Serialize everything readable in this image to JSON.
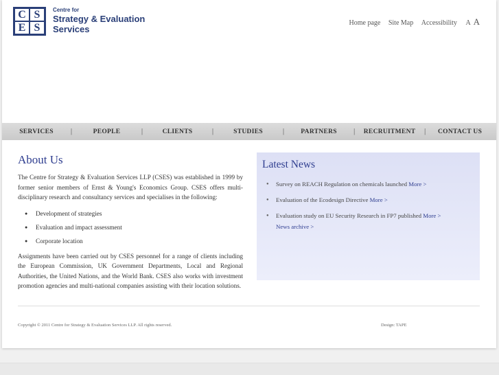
{
  "logo": {
    "letters": [
      "C",
      "S",
      "E",
      "S"
    ],
    "line1": "Centre for",
    "line2": "Strategy & Evaluation",
    "line3": "Services"
  },
  "toplinks": {
    "home": "Home page",
    "sitemap": "Site Map",
    "accessibility": "Accessibility",
    "text_small": "A",
    "text_large": "A"
  },
  "nav": {
    "items": [
      "SERVICES",
      "PEOPLE",
      "CLIENTS",
      "STUDIES",
      "PARTNERS",
      "RECRUITMENT",
      "CONTACT US"
    ],
    "separator": "|"
  },
  "about": {
    "title": "About Us",
    "intro": "The Centre for Strategy & Evaluation Services LLP (CSES) was established in 1999 by former senior members of Ernst & Young's Economics Group. CSES offers multi-disciplinary research and consultancy services and specialises in the following:",
    "bullets": [
      "Development of strategies",
      "Evaluation and impact assessment",
      "Corporate location"
    ],
    "body": "Assignments have been carried out by CSES personnel for a range of clients including the European Commission, UK Government Departments, Local and Regional Authorities, the United Nations, and the World Bank. CSES also works with investment promotion agencies and multi-national companies assisting with their location solutions."
  },
  "news": {
    "title": "Latest News",
    "items": [
      {
        "text": "Survey on REACH Regulation on chemicals launched ",
        "more": "More >"
      },
      {
        "text": "Evaluation of the Ecodesign Directive ",
        "more": "More >"
      },
      {
        "text": "Evaluation study on EU Security Research in FP7 published ",
        "more": "More >"
      }
    ],
    "archive": "News archive >"
  },
  "footer": {
    "copyright": "Copyright © 2011 Centre for Strategy & Evaluation Services LLP. All rights reserved.",
    "design": "Design: TAPE"
  },
  "colors": {
    "brand": "#2a3f78",
    "heading": "#2e3d8f",
    "news_bg": "#e4e6f8",
    "nav_bg": "#d3d3d3"
  }
}
